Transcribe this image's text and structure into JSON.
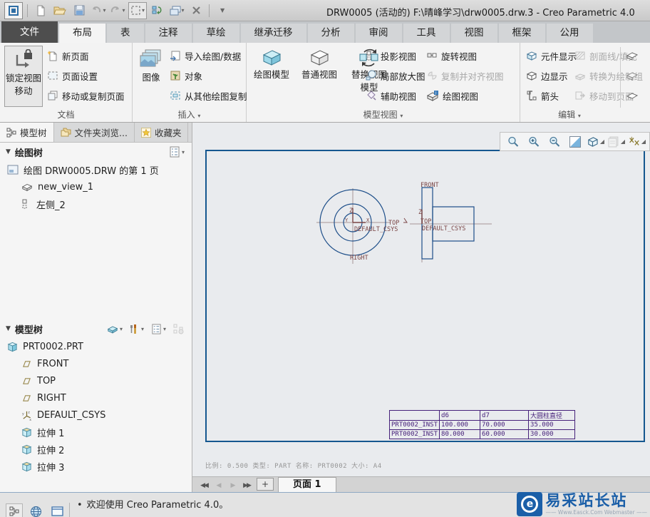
{
  "titlebar": {
    "title": "DRW0005 (活动的) F:\\晴峰学习\\drw0005.drw.3 - Creo Parametric 4.0"
  },
  "tabs": [
    "文件",
    "布局",
    "表",
    "注释",
    "草绘",
    "继承迁移",
    "分析",
    "审阅",
    "工具",
    "视图",
    "框架",
    "公用"
  ],
  "ribbon": {
    "lock_view_line1": "锁定视图",
    "lock_view_line2": "移动",
    "new_page": "新页面",
    "page_setup": "页面设置",
    "move_copy_page": "移动或复制页面",
    "image": "图像",
    "import_drawing": "导入绘图/数据",
    "object": "对象",
    "copy_from_other": "从其他绘图复制",
    "drawing_model": "绘图模型",
    "general_view": "普通视图",
    "replace_view_line1": "替换视图",
    "replace_view_line2": "模型",
    "projection_view": "投影视图",
    "detail_view": "局部放大图",
    "aux_view": "辅助视图",
    "rotate_view": "旋转视图",
    "copy_align_view": "复制并对齐视图",
    "drawing_view": "绘图视图",
    "component_display": "元件显示",
    "edge_display": "边显示",
    "arrows": "箭头",
    "hatch_fill": "剖面线/填充",
    "convert_draft": "转换为绘制组",
    "move_to_page": "移动到页面",
    "group_doc": "文档",
    "group_insert": "插入",
    "group_model_views": "模型视图",
    "group_edit": "编辑"
  },
  "navigator": {
    "tab_model_tree": "模型树",
    "tab_folder": "文件夹浏览...",
    "tab_favorites": "收藏夹",
    "drawing_tree_header": "绘图树",
    "drawing_tree": [
      "绘图 DRW0005.DRW 的第 1 页",
      "new_view_1",
      "左侧_2"
    ],
    "model_tree_header": "模型树",
    "model_tree": [
      "PRT0002.PRT",
      "FRONT",
      "TOP",
      "RIGHT",
      "DEFAULT_CSYS",
      "拉伸 1",
      "拉伸 2",
      "拉伸 3"
    ]
  },
  "drawing": {
    "front_view": {
      "z": "Z",
      "y": "Y",
      "x": "X",
      "top": "TOP",
      "csys": "DEFAULT_CSYS",
      "right": "RIGHT"
    },
    "side_view": {
      "front": "FRONT",
      "z": "Z",
      "top": "TOP",
      "csys": "DEFAULT_CSYS"
    },
    "table": {
      "headers": [
        "",
        "d6",
        "d7",
        "大圆柱直径"
      ],
      "rows": [
        [
          "PRT0002_INST",
          "100.000",
          "70.000",
          "35.000"
        ],
        [
          "PRT0002_INST",
          "80.000",
          "60.000",
          "30.000"
        ]
      ]
    },
    "sheet_info": "比例: 0.500   类型: PART   名称: PRT0002   大小: A4"
  },
  "page_bar": {
    "page_tab": "页面 1",
    "add_label": "+"
  },
  "status": {
    "message": "欢迎使用 Creo Parametric 4.0。"
  },
  "watermark": {
    "title": "易采站长站",
    "subtitle": "—— Www.Easck.Com Webmaster ——"
  },
  "colors": {
    "sheet_border": "#15578f",
    "geometry_blue": "#1d4e89",
    "datum_maroon": "#7a4545",
    "table_purple": "#46217a"
  }
}
